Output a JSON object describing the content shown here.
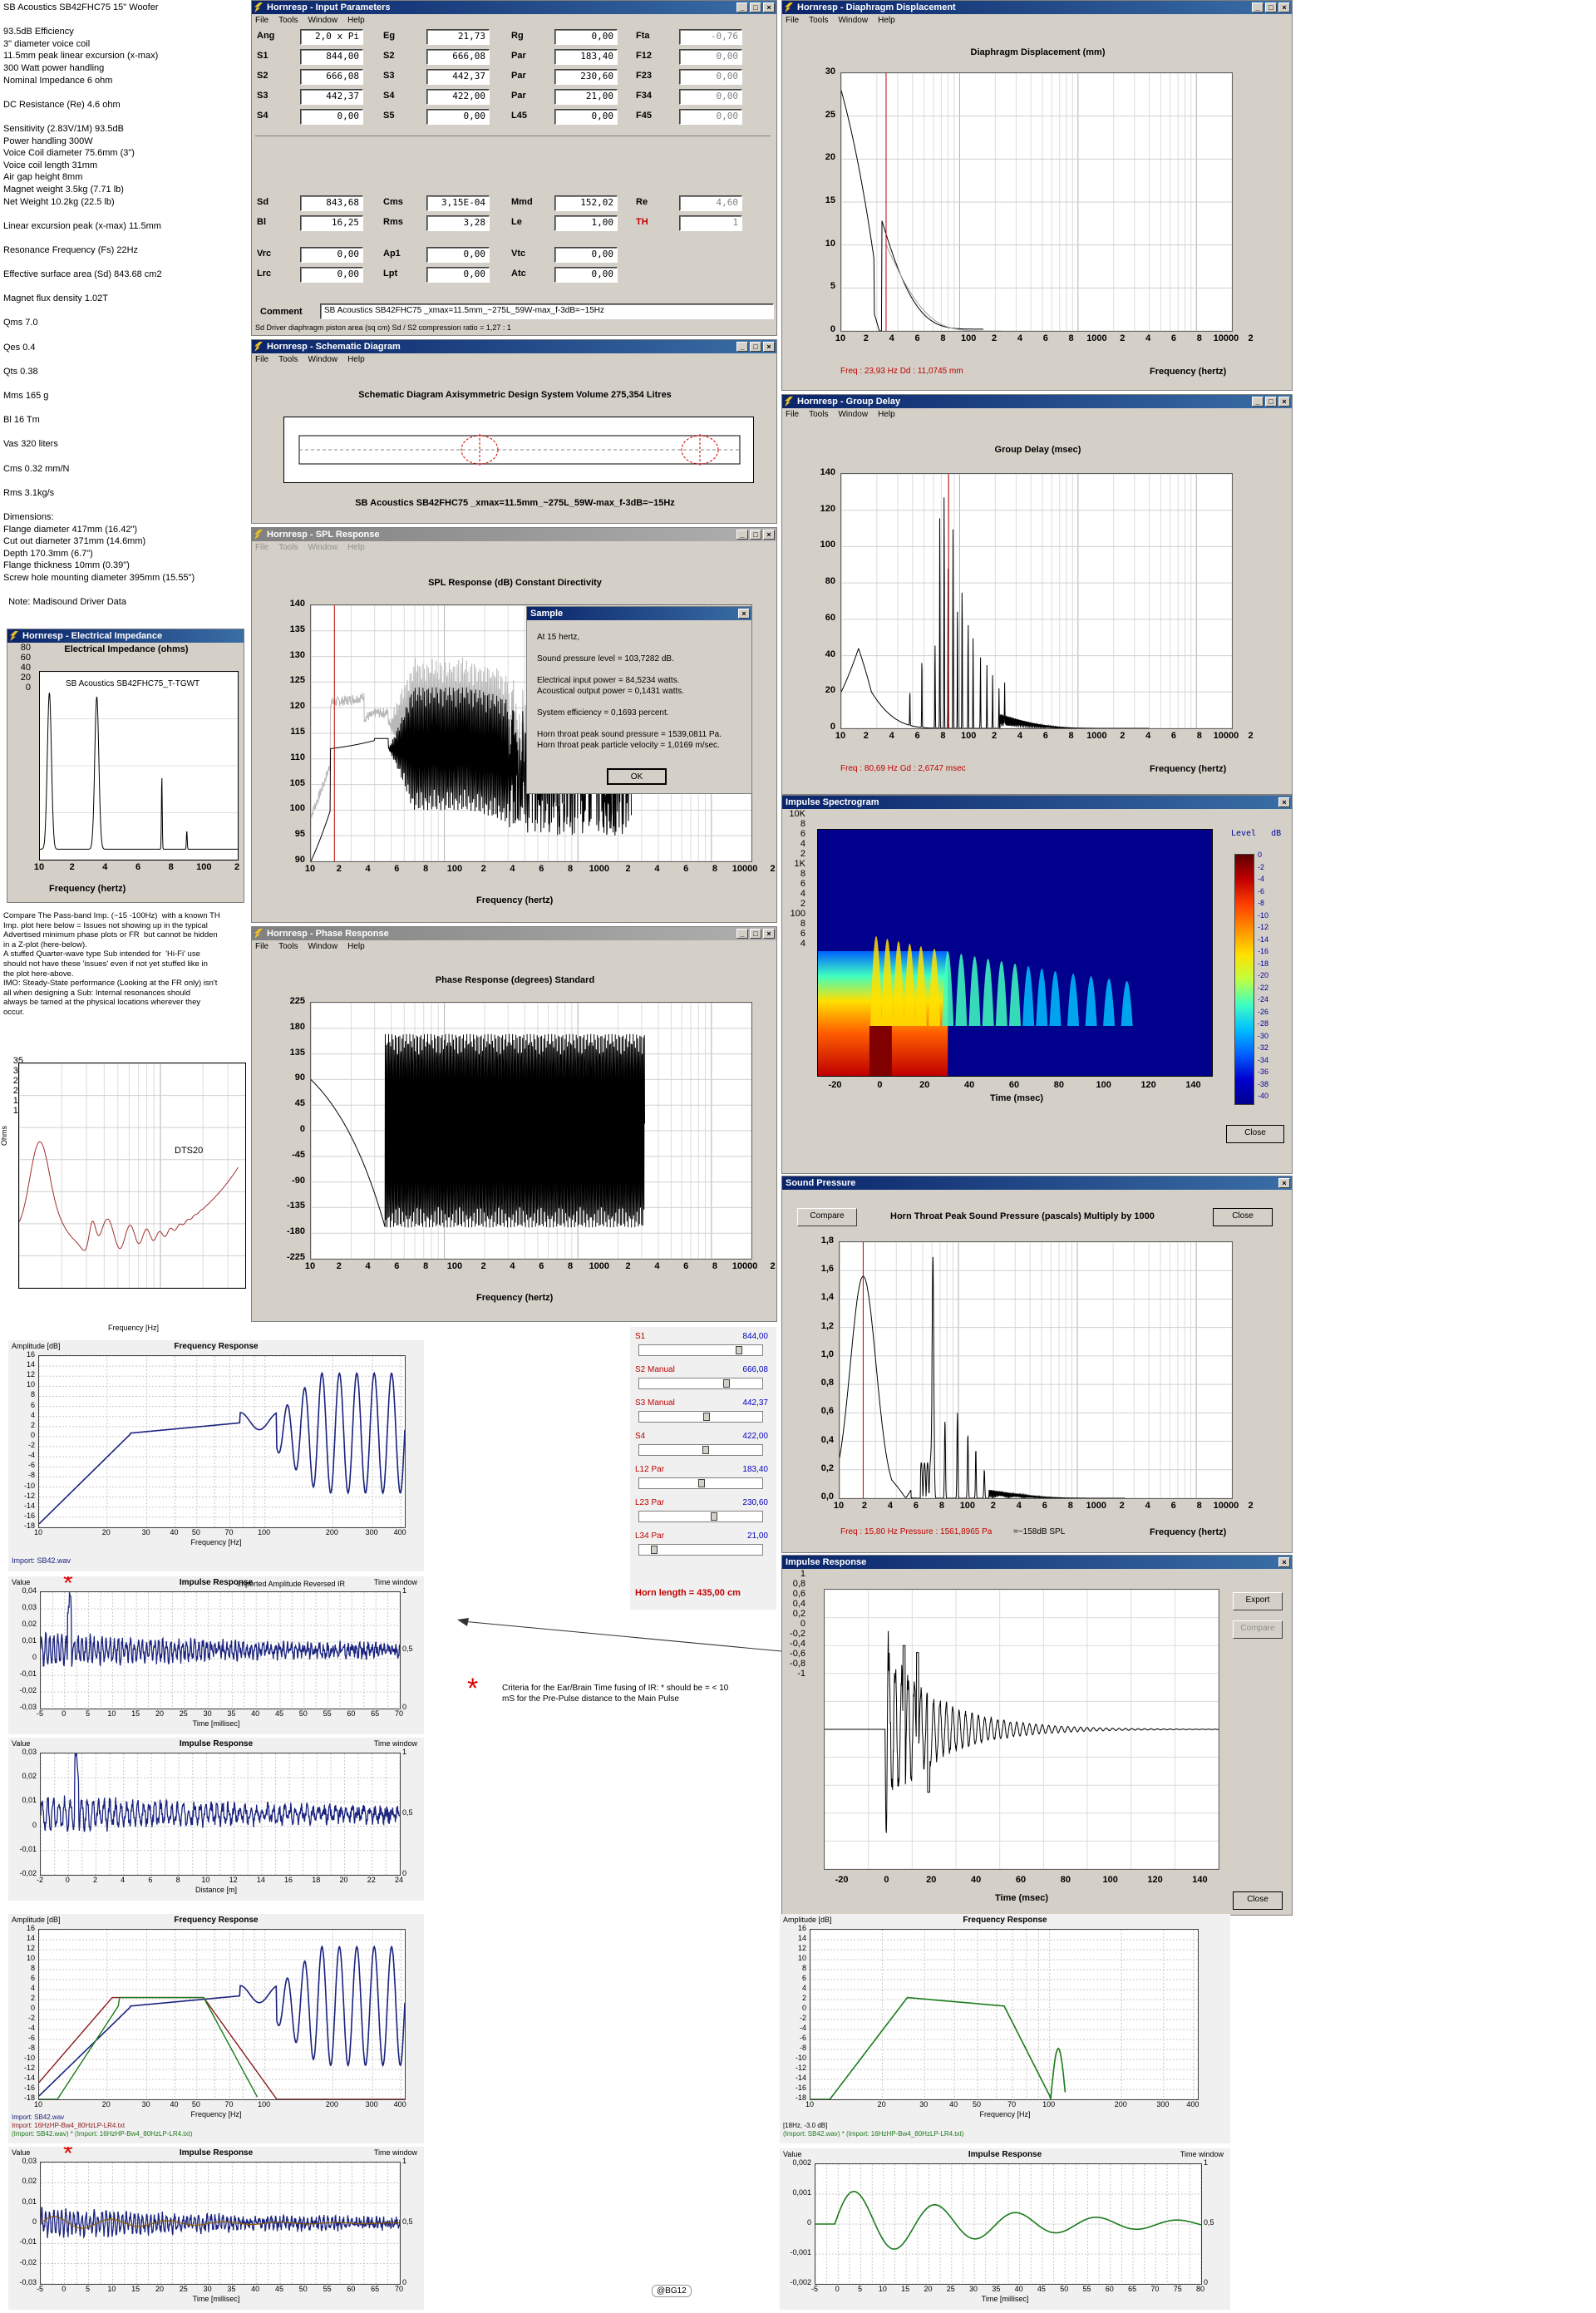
{
  "notes_left": {
    "header": "SB Acoustics SB42FHC75 15\" Woofer",
    "lines": [
      "93.5dB Efficiency",
      "3\" diameter voice coil",
      "11.5mm peak linear excursion (x-max)",
      "300 Watt power handling",
      "Nominal Impedance 6 ohm",
      "",
      "DC Resistance (Re) 4.6 ohm",
      "",
      "Sensitivity (2.83V/1M) 93.5dB",
      "Power handling 300W",
      "Voice Coil diameter 75.6mm (3\")",
      "Voice coil length 31mm",
      "Air gap height 8mm",
      "Magnet weight 3.5kg (7.71 lb)",
      "Net Weight 10.2kg (22.5 lb)",
      "",
      "Linear excursion peak (x-max) 11.5mm",
      "",
      "Resonance Frequency (Fs) 22Hz",
      "",
      "Effective surface area (Sd) 843.68 cm2",
      "",
      "Magnet flux density 1.02T",
      "",
      "Qms 7.0",
      "",
      "Qes 0.4",
      "",
      "Qts 0.38",
      "",
      "Mms 165 g",
      "",
      "Bl 16 Tm",
      "",
      "Vas 320 liters",
      "",
      "Cms 0.32 mm/N",
      "",
      "Rms 3.1kg/s",
      "",
      "Dimensions:",
      "Flange diameter 417mm (16.42\")",
      "Cut out diameter 371mm (14.6mm)",
      "Depth 170.3mm (6.7\")",
      "Flange thickness 10mm (0.39\")",
      "Screw hole mounting diameter 395mm (15.55\")",
      "",
      "  Note: Madisound Driver Data"
    ]
  },
  "compare_notes": "Compare The Pass-band Imp. (~15 -100Hz)  with a known TH\nImp. plot here below = Issues not showing up in the typical\nAdvertised minimum phase plots or FR  but cannot be hidden\nin a Z-plot (here-below).\nA stuffed Quarter-wave type Sub intended for  'Hi-Fi' use\nshould not have these 'issues' even if not yet stuffed like in\nthe plot here-above.\nIMO: Steady-State performance (Looking at the FR only) isn't\nall when designing a Sub: Internal resonances should\nalways be tamed at the physical locations wherever they\noccur.",
  "menu": [
    "File",
    "Tools",
    "Window",
    "Help"
  ],
  "windows": {
    "input": "Hornresp - Input Parameters",
    "diaphragm": "Hornresp - Diaphragm Displacement",
    "schematic": "Hornresp - Schematic Diagram",
    "spl": "Hornresp - SPL Response",
    "group": "Hornresp - Group Delay",
    "impedance": "Hornresp - Electrical Impedance",
    "phase": "Hornresp - Phase Response",
    "spectrogram": "Impulse Spectrogram",
    "pressure": "Sound Pressure",
    "impulse": "Impulse Response"
  },
  "input_params": {
    "rows1": [
      [
        [
          "Ang",
          "2,0 x Pi"
        ],
        [
          "Eg",
          "21,73"
        ],
        [
          "Rg",
          "0,00"
        ],
        [
          "Fta",
          "-0,76"
        ]
      ],
      [
        [
          "S1",
          "844,00"
        ],
        [
          "S2",
          "666,08"
        ],
        [
          "Par",
          "183,40"
        ],
        [
          "F12",
          "0,00"
        ]
      ],
      [
        [
          "S2",
          "666,08"
        ],
        [
          "S3",
          "442,37"
        ],
        [
          "Par",
          "230,60"
        ],
        [
          "F23",
          "0,00"
        ]
      ],
      [
        [
          "S3",
          "442,37"
        ],
        [
          "S4",
          "422,00"
        ],
        [
          "Par",
          "21,00"
        ],
        [
          "F34",
          "0,00"
        ]
      ],
      [
        [
          "S4",
          "0,00"
        ],
        [
          "S5",
          "0,00"
        ],
        [
          "L45",
          "0,00"
        ],
        [
          "F45",
          "0,00"
        ]
      ]
    ],
    "rows2": [
      [
        [
          "Sd",
          "843,68"
        ],
        [
          "Cms",
          "3,15E-04"
        ],
        [
          "Mmd",
          "152,02"
        ],
        [
          "Re",
          "4,60"
        ]
      ],
      [
        [
          "Bl",
          "16,25"
        ],
        [
          "Rms",
          "3,28"
        ],
        [
          "Le",
          "1,00"
        ],
        [
          "TH",
          "1"
        ]
      ],
      [
        [
          "Vrc",
          "0,00"
        ],
        [
          "Ap1",
          "0,00"
        ],
        [
          "Vtc",
          "0,00"
        ],
        [
          "",
          ""
        ]
      ],
      [
        [
          "Lrc",
          "0,00"
        ],
        [
          "Lpt",
          "0,00"
        ],
        [
          "Atc",
          "0,00"
        ],
        [
          "",
          ""
        ]
      ]
    ],
    "comment_label": "Comment",
    "comment": "SB Acoustics SB42FHC75 _xmax=11.5mm_~275L_59W-max_f-3dB=~15Hz",
    "status": "Sd   Driver diaphragm piston area  (sq cm)    Sd / S2 compression ratio = 1,27 : 1"
  },
  "schematic": {
    "title": "Schematic Diagram    Axisymmetric Design    System Volume 275,354 Litres",
    "caption": "SB Acoustics SB42FHC75 _xmax=11.5mm_~275L_59W-max_f-3dB=~15Hz"
  },
  "spl_title": "SPL Response (dB)    Constant Directivity",
  "spl_y": [
    "140",
    "135",
    "130",
    "125",
    "120",
    "115",
    "110",
    "105",
    "100",
    "95",
    "90"
  ],
  "freq_ticks": [
    "10",
    "2",
    "4",
    "6",
    "8",
    "100",
    "2",
    "4",
    "6",
    "8",
    "1000",
    "2",
    "4",
    "6",
    "8",
    "10000",
    "2"
  ],
  "freq_label": "Frequency (hertz)",
  "sample_dialog": {
    "title": "Sample",
    "line1": "At 15 hertz,",
    "line2": "Sound pressure level = 103,7282 dB.",
    "line3": "Electrical input power = 84,5234 watts.",
    "line4": "Acoustical output power = 0,1431 watts.",
    "line5": "System efficiency = 0,1693 percent.",
    "line6": "Horn throat peak sound pressure = 1539,0811 Pa.",
    "line7": "Horn throat peak particle velocity = 1,0169 m/sec.",
    "ok": "OK"
  },
  "diaphragm": {
    "title": "Diaphragm Displacement (mm)",
    "y": [
      "30",
      "25",
      "20",
      "15",
      "10",
      "5",
      "0"
    ],
    "stat": "Freq : 23,93 Hz      Dd : 11,0745 mm"
  },
  "group": {
    "title": "Group Delay (msec)",
    "y": [
      "140",
      "120",
      "100",
      "80",
      "60",
      "40",
      "20",
      "0"
    ],
    "stat": "Freq : 80,69 Hz      Gd : 2,6747 msec"
  },
  "impedance": {
    "title": "Electrical Impedance (ohms)",
    "inner": "SB Acoustics SB42FHC75_T-TGWT",
    "y": [
      "80",
      "60",
      "40",
      "20",
      "0"
    ],
    "x": [
      "10",
      "2",
      "4",
      "6",
      "8",
      "100",
      "2"
    ],
    "xlabel": "Frequency (hertz)"
  },
  "dts": {
    "label": "DTS20",
    "y": [
      "35",
      "30",
      "25",
      "20",
      "15",
      "10",
      "5"
    ],
    "yunit": "Ohms",
    "x": [
      "10",
      "20",
      "30",
      "40",
      "50",
      "70",
      "100",
      "200",
      "300"
    ],
    "xlabel": "Frequency [Hz]"
  },
  "phase": {
    "title": "Phase Response (degrees)    Standard",
    "y": [
      "225",
      "180",
      "135",
      "90",
      "45",
      "0",
      "-45",
      "-90",
      "-135",
      "-180",
      "-225"
    ]
  },
  "spectrogram": {
    "ylab_top": "10K",
    "y": [
      "10K",
      "8",
      "6",
      "4",
      "2",
      "1K",
      "8",
      "6",
      "4",
      "2",
      "100",
      "8",
      "6",
      "4"
    ],
    "x": [
      "-20",
      "0",
      "20",
      "40",
      "60",
      "80",
      "100",
      "120",
      "140"
    ],
    "xlabel": "Time (msec)",
    "legend_title": "Level   dB",
    "legend": [
      "0",
      "-2",
      "-4",
      "-6",
      "-8",
      "-10",
      "-12",
      "-14",
      "-16",
      "-18",
      "-20",
      "-22",
      "-24",
      "-26",
      "-28",
      "-30",
      "-32",
      "-34",
      "-36",
      "-38",
      "-40"
    ],
    "close": "Close"
  },
  "pressure": {
    "compare": "Compare",
    "title": "Horn Throat Peak Sound Pressure (pascals)    Multiply by 1000",
    "close": "Close",
    "y": [
      "1,8",
      "1,6",
      "1,4",
      "1,2",
      "1,0",
      "0,8",
      "0,6",
      "0,4",
      "0,2",
      "0,0"
    ],
    "stat": "Freq : 15,80 Hz      Pressure : 1561,8965 Pa",
    "stat2": "=~158dB SPL"
  },
  "impulse": {
    "export": "Export",
    "compare": "Compare",
    "close": "Close",
    "y": [
      "1",
      "0,8",
      "0,6",
      "0,4",
      "0,2",
      "0",
      "-0,2",
      "-0,4",
      "-0,6",
      "-0,8",
      "-1"
    ],
    "x": [
      "-20",
      "0",
      "20",
      "40",
      "60",
      "80",
      "100",
      "120",
      "140"
    ],
    "xlabel": "Time (msec)"
  },
  "sliders": [
    {
      "name": "S1",
      "mode": "",
      "value": "844,00",
      "pos": 0.72
    },
    {
      "name": "S2",
      "mode": "Manual",
      "value": "666,08",
      "pos": 0.62
    },
    {
      "name": "S3",
      "mode": "Manual",
      "value": "442,37",
      "pos": 0.46
    },
    {
      "name": "S4",
      "mode": "",
      "value": "422,00",
      "pos": 0.45
    },
    {
      "name": "L12",
      "mode": "Par",
      "value": "183,40",
      "pos": 0.42
    },
    {
      "name": "L23",
      "mode": "Par",
      "value": "230,60",
      "pos": 0.52
    },
    {
      "name": "L34",
      "mode": "Par",
      "value": "21,00",
      "pos": 0.04
    }
  ],
  "horn_length": "Horn length = 435,00 cm",
  "rew_fr1": {
    "amp": "Amplitude [dB]",
    "title": "Frequency Response",
    "y": [
      "16",
      "14",
      "12",
      "10",
      "8",
      "6",
      "4",
      "2",
      "0",
      "-2",
      "-4",
      "-6",
      "-8",
      "-10",
      "-12",
      "-14",
      "-16",
      "-18"
    ],
    "x": [
      "10",
      "20",
      "30",
      "40",
      "50",
      "70",
      "100",
      "200",
      "300",
      "400"
    ],
    "xlabel": "Frequency [Hz]",
    "legend": "Import: SB42.wav"
  },
  "rew_ir1": {
    "value": "Value",
    "title": "Impulse Response",
    "subtitle": "Imported Amplitude Reversed IR",
    "tw": "Time window",
    "y": [
      "0,04",
      "0,03",
      "0,02",
      "0,01",
      "0",
      "-0,01",
      "-0,02",
      "-0,03"
    ],
    "yr": [
      "1",
      "0,5",
      "0"
    ],
    "x": [
      "-5",
      "0",
      "5",
      "10",
      "15",
      "20",
      "25",
      "30",
      "35",
      "40",
      "45",
      "50",
      "55",
      "60",
      "65",
      "70"
    ],
    "xlabel": "Time [millisec]"
  },
  "criteria": "Criteria for the Ear/Brain Time fusing of IR: * should be = < 10\nmS for the Pre-Pulse distance to the Main Pulse",
  "rew_ir2": {
    "value": "Value",
    "title": "Impulse Response",
    "tw": "Time window",
    "y": [
      "0,03",
      "0,02",
      "0,01",
      "0",
      "-0,01",
      "-0,02"
    ],
    "yr": [
      "1",
      "0,5",
      "0"
    ],
    "x": [
      "-2",
      "0",
      "2",
      "4",
      "6",
      "8",
      "10",
      "12",
      "14",
      "16",
      "18",
      "20",
      "22",
      "24"
    ],
    "xlabel": "Distance [m]"
  },
  "rew_fr2": {
    "amp": "Amplitude [dB]",
    "title": "Frequency Response",
    "y": [
      "16",
      "14",
      "12",
      "10",
      "8",
      "6",
      "4",
      "2",
      "0",
      "-2",
      "-4",
      "-6",
      "-8",
      "-10",
      "-12",
      "-14",
      "-16",
      "-18"
    ],
    "x": [
      "10",
      "20",
      "30",
      "40",
      "50",
      "70",
      "100",
      "200",
      "300",
      "400"
    ],
    "xlabel": "Frequency [Hz]",
    "legend1": "Import: SB42.wav",
    "legend2": "Import: 16HzHP-Bw4_80HzLP-LR4.txt",
    "legend3": "(Import: SB42.wav) * (Import: 16HzHP-Bw4_80HzLP-LR4.txt)"
  },
  "rew_ir3": {
    "value": "Value",
    "title": "Impulse Response",
    "tw": "Time window",
    "y": [
      "0,03",
      "0,02",
      "0,01",
      "0",
      "-0,01",
      "-0,02",
      "-0,03"
    ],
    "yr": [
      "1",
      "0,5",
      "0"
    ],
    "x": [
      "-5",
      "0",
      "5",
      "10",
      "15",
      "20",
      "25",
      "30",
      "35",
      "40",
      "45",
      "50",
      "55",
      "60",
      "65",
      "70"
    ],
    "xlabel": "Time [millisec]"
  },
  "rew_fr3": {
    "amp": "Amplitude [dB]",
    "title": "Frequency Response",
    "y": [
      "16",
      "14",
      "12",
      "10",
      "8",
      "6",
      "4",
      "2",
      "0",
      "-2",
      "-4",
      "-6",
      "-8",
      "-10",
      "-12",
      "-14",
      "-16",
      "-18"
    ],
    "x": [
      "10",
      "20",
      "30",
      "40",
      "50",
      "70",
      "100",
      "200",
      "300",
      "400"
    ],
    "xlabel": "Frequency [Hz]",
    "legend0": "[18Hz, -3.0 dB]",
    "legend": "(Import: SB42.wav) * (Import: 16HzHP-Bw4_80HzLP-LR4.txt)"
  },
  "rew_ir4": {
    "value": "Value",
    "title": "Impulse Response",
    "tw": "Time window",
    "y": [
      "0,002",
      "0,001",
      "0",
      "-0,001",
      "-0,002"
    ],
    "yr": [
      "1",
      "0,5",
      "0"
    ],
    "x": [
      "-5",
      "0",
      "5",
      "10",
      "15",
      "20",
      "25",
      "30",
      "35",
      "40",
      "45",
      "50",
      "55",
      "60",
      "65",
      "70",
      "75",
      "80"
    ],
    "xlabel": "Time [millisec]"
  },
  "copyright": "@BG12"
}
